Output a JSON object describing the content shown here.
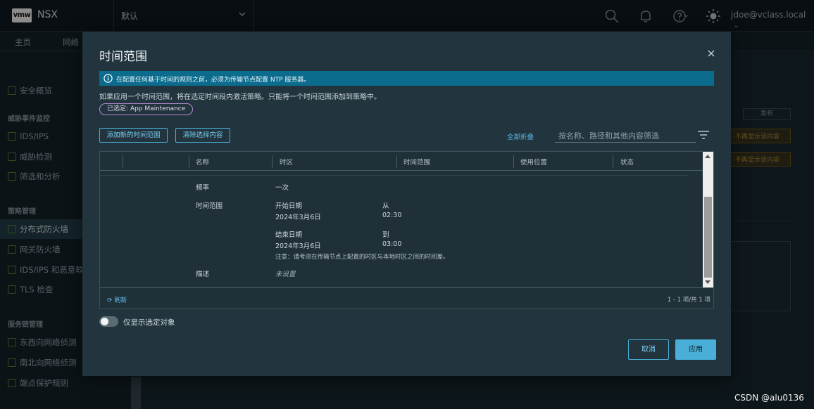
{
  "header": {
    "logo": "vmw",
    "app_name": "NSX",
    "context": "默认",
    "user": "jdoe@vclass.local"
  },
  "nav": {
    "tabs": [
      "主页",
      "网络"
    ]
  },
  "sidebar": {
    "items": [
      {
        "type": "item",
        "label": "安全概览"
      },
      {
        "type": "head",
        "label": "威胁事件监控"
      },
      {
        "type": "item",
        "label": "IDS/IPS"
      },
      {
        "type": "item",
        "label": "威胁检测"
      },
      {
        "type": "item",
        "label": "筛选和分析"
      },
      {
        "type": "head",
        "label": "策略管理"
      },
      {
        "type": "item",
        "label": "分布式防火墙",
        "active": true
      },
      {
        "type": "item",
        "label": "网关防火墙"
      },
      {
        "type": "item",
        "label": "IDS/IPS 和恶意软"
      },
      {
        "type": "item",
        "label": "TLS 检查"
      },
      {
        "type": "head",
        "label": "服务链管理"
      },
      {
        "type": "item",
        "label": "东西向网络侦测"
      },
      {
        "type": "item",
        "label": "南北向网络侦测"
      },
      {
        "type": "item",
        "label": "端点保护规则"
      }
    ]
  },
  "background": {
    "publish_label": "发布",
    "warn_1": "不再显示该内容",
    "warn_2": "不再显示该内容"
  },
  "modal": {
    "title": "时间范围",
    "info": "在配置任何基于时间的规则之前，必须为传输节点配置 NTP 服务器。",
    "description": "如果应用一个时间范围，将在选定时间段内激活策略。只能将一个时间范围添加到策略中。",
    "chip": "已选定: App Maintenance",
    "add_button": "添加新的时间范围",
    "clear_button": "清除选择内容",
    "collapse_all": "全部折叠",
    "search_placeholder": "按名称、路径和其他内容筛选",
    "columns": [
      "名称",
      "时区",
      "时间范围",
      "使用位置",
      "状态"
    ],
    "detail": {
      "frequency_label": "频率",
      "frequency_value": "一次",
      "time_range_label": "时间范围",
      "start_date_label": "开始日期",
      "start_date": "2024年3月6日",
      "from_label": "从",
      "from_time": "02:30",
      "end_date_label": "结束日期",
      "end_date": "2024年3月6日",
      "to_label": "到",
      "to_time": "03:00",
      "note": "注意：请考虑在传输节点上配置的时区与本地时区之间的时间差。",
      "description_label": "描述",
      "description_value": "未设置"
    },
    "refresh": "刷新",
    "pagination": "1 - 1 项/共 1 项",
    "toggle_label": "仅显示选定对象",
    "cancel": "取消",
    "apply": "应用"
  },
  "watermark": "CSDN @alu0136",
  "colors": {
    "accent": "#49afd9",
    "info_bar": "#0b6c8e",
    "chip_border": "#b68cd2"
  }
}
